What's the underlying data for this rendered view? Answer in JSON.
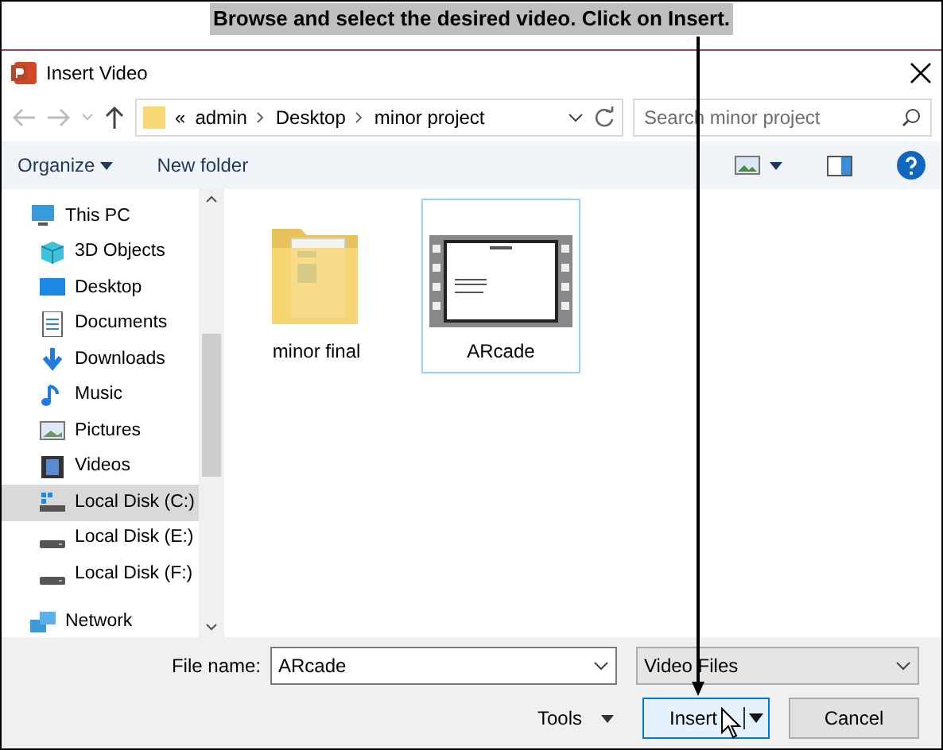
{
  "caption": "Browse and select the desired video. Click on Insert.",
  "window": {
    "title": "Insert Video"
  },
  "address": {
    "overflow": "«",
    "crumbs": [
      "admin",
      "Desktop",
      "minor project"
    ]
  },
  "search": {
    "placeholder": "Search minor project"
  },
  "toolbar": {
    "organize": "Organize",
    "new_folder": "New folder"
  },
  "sidebar": {
    "items": [
      {
        "label": "This PC",
        "kind": "pc",
        "selected": false,
        "children": [
          {
            "label": "3D Objects",
            "kind": "cube",
            "selected": false
          },
          {
            "label": "Desktop",
            "kind": "desktop",
            "selected": false
          },
          {
            "label": "Documents",
            "kind": "docs",
            "selected": false
          },
          {
            "label": "Downloads",
            "kind": "download",
            "selected": false
          },
          {
            "label": "Music",
            "kind": "music",
            "selected": false
          },
          {
            "label": "Pictures",
            "kind": "pictures",
            "selected": false
          },
          {
            "label": "Videos",
            "kind": "videos",
            "selected": false
          },
          {
            "label": "Local Disk (C:)",
            "kind": "sysdisk",
            "selected": true
          },
          {
            "label": "Local Disk (E:)",
            "kind": "disk",
            "selected": false
          },
          {
            "label": "Local Disk (F:)",
            "kind": "disk",
            "selected": false
          }
        ]
      },
      {
        "label": "Network",
        "kind": "network",
        "selected": false
      }
    ]
  },
  "files": [
    {
      "name": "minor final",
      "kind": "folder",
      "selected": false
    },
    {
      "name": "ARcade",
      "kind": "video",
      "selected": true
    }
  ],
  "file_name": {
    "label": "File name:",
    "value": "ARcade"
  },
  "file_type": "Video Files",
  "buttons": {
    "tools": "Tools",
    "insert": "Insert",
    "cancel": "Cancel"
  }
}
